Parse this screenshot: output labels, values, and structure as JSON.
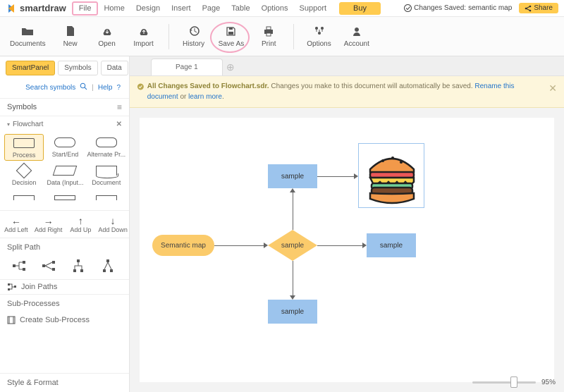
{
  "brand": "smartdraw",
  "menubar": {
    "items": [
      "File",
      "Home",
      "Design",
      "Insert",
      "Page",
      "Table",
      "Options",
      "Support"
    ],
    "buy": "Buy",
    "status_prefix": "Changes Saved:",
    "status_file": "semantic map",
    "share": "Share"
  },
  "toolbar": {
    "items": [
      {
        "id": "documents",
        "label": "Documents",
        "icon": "folder"
      },
      {
        "id": "new",
        "label": "New",
        "icon": "file"
      },
      {
        "id": "open",
        "label": "Open",
        "icon": "cloud-down"
      },
      {
        "id": "import",
        "label": "Import",
        "icon": "cloud-up"
      },
      {
        "id": "history",
        "label": "History",
        "icon": "history"
      },
      {
        "id": "saveas",
        "label": "Save As",
        "icon": "floppy",
        "circled": true
      },
      {
        "id": "print",
        "label": "Print",
        "icon": "printer"
      },
      {
        "id": "options",
        "label": "Options",
        "icon": "sliders"
      },
      {
        "id": "account",
        "label": "Account",
        "icon": "user"
      }
    ]
  },
  "panel": {
    "tabs": [
      "SmartPanel",
      "Symbols",
      "Data"
    ],
    "active_tab": 0,
    "search_label": "Search symbols",
    "help_label": "Help",
    "symbols_header": "Symbols",
    "category": "Flowchart",
    "shapes": [
      "Process",
      "Start/End",
      "Alternate Pr...",
      "Decision",
      "Data (Input...",
      "Document"
    ],
    "selected_shape": 0,
    "arrow_row": [
      "Add Left",
      "Add Right",
      "Add Up",
      "Add Down"
    ],
    "split_header": "Split Path",
    "join_label": "Join Paths",
    "sub_header": "Sub-Processes",
    "create_sub": "Create Sub-Process",
    "style_header": "Style & Format"
  },
  "pages": {
    "tab": "Page 1"
  },
  "notice": {
    "lead": "All Changes Saved to Flowchart.sdr.",
    "body": "Changes you make to this document will automatically be saved.",
    "rename": "Rename this document",
    "or": "or",
    "learn": "learn more",
    "dot": "."
  },
  "flow": {
    "start": "Semantic map",
    "decision": "sample",
    "top": "sample",
    "right": "sample",
    "bottom": "sample"
  },
  "zoom": {
    "unit": "95%"
  },
  "colors": {
    "accent": "#ffcb4f",
    "blue": "#9cc4ed",
    "orange": "#fbcb6b",
    "pink_highlight": "#f4a8c3"
  }
}
